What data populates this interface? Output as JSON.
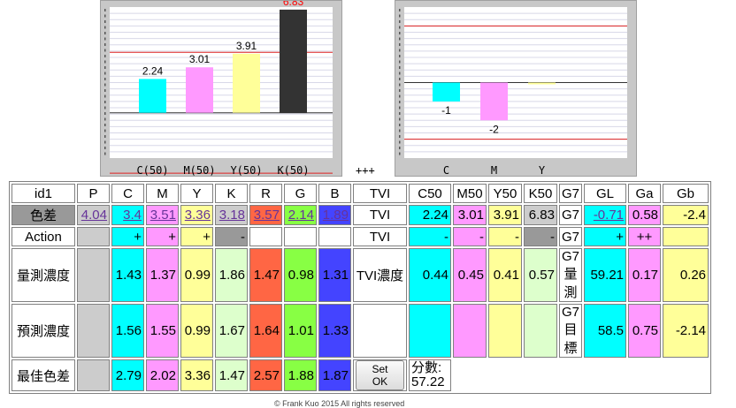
{
  "chart_data": [
    {
      "type": "bar",
      "categories": [
        "C(50)",
        "M(50)",
        "Y(50)",
        "K(50)"
      ],
      "values": [
        2.24,
        3.01,
        3.91,
        6.83
      ],
      "value_labels": [
        "2.24",
        "3.01",
        "3.91",
        "6.83"
      ],
      "colors": [
        "#00ffff",
        "#ff99ff",
        "#ffff99",
        "#333333"
      ],
      "label_colors": [
        "#000000",
        "#000000",
        "#000000",
        "#ff0000"
      ],
      "ylim": [
        -3,
        7
      ],
      "reference_lines": [
        4,
        0,
        -4
      ],
      "grid": true
    },
    {
      "type": "bar",
      "categories": [
        "C",
        "M",
        "Y"
      ],
      "values": [
        -1,
        -2,
        0
      ],
      "value_labels": [
        "-1",
        "-2",
        ""
      ],
      "colors": [
        "#00ffff",
        "#ff99ff",
        "#ffff99"
      ],
      "ylim": [
        -4,
        4
      ],
      "reference_lines": [
        3,
        0,
        -3
      ],
      "grid": true
    }
  ],
  "separator": "+++",
  "header": [
    "id1",
    "P",
    "C",
    "M",
    "Y",
    "K",
    "R",
    "G",
    "B",
    "TVI",
    "C50",
    "M50",
    "Y50",
    "K50",
    "G7",
    "GL",
    "Ga",
    "Gb"
  ],
  "diff": {
    "label": "色差",
    "values": [
      "4.04",
      "3.4",
      "3.51",
      "3.36",
      "3.18",
      "3.57",
      "2.14",
      "1.89"
    ],
    "tvi": "TVI",
    "tvi_values": [
      "2.24",
      "3.01",
      "3.91",
      "6.83"
    ],
    "g7": "G7",
    "g_values": [
      "-0.71",
      "0.58",
      "-2.4"
    ]
  },
  "action": {
    "label": "Action",
    "values": [
      "",
      "+",
      "+",
      "+",
      "-",
      "",
      "",
      ""
    ],
    "tvi": "TVI",
    "tvi_values": [
      "-",
      "-",
      "-",
      "-"
    ],
    "g7": "G7",
    "g_values": [
      "+",
      "++",
      ""
    ]
  },
  "measured": {
    "label": "量測濃度",
    "values": [
      "",
      "1.43",
      "1.37",
      "0.99",
      "1.86",
      "1.47",
      "0.98",
      "1.31"
    ],
    "tvi_label": "TVI濃度",
    "tvi_values": [
      "0.44",
      "0.45",
      "0.41",
      "0.57"
    ],
    "g7_label": "G7量測",
    "g_values": [
      "59.21",
      "0.17",
      "0.26"
    ]
  },
  "predicted": {
    "label": "預測濃度",
    "values": [
      "",
      "1.56",
      "1.55",
      "0.99",
      "1.67",
      "1.64",
      "1.01",
      "1.33"
    ],
    "g7_label": "G7目標",
    "g_values": [
      "58.5",
      "0.75",
      "-2.14"
    ]
  },
  "best": {
    "label": "最佳色差",
    "values": [
      "",
      "2.79",
      "2.02",
      "3.36",
      "1.47",
      "2.57",
      "1.88",
      "1.87"
    ],
    "button": "Set OK",
    "score_label": "分數:",
    "score": "57.22"
  },
  "footer": "© Frank Kuo 2015 All rights reserved"
}
